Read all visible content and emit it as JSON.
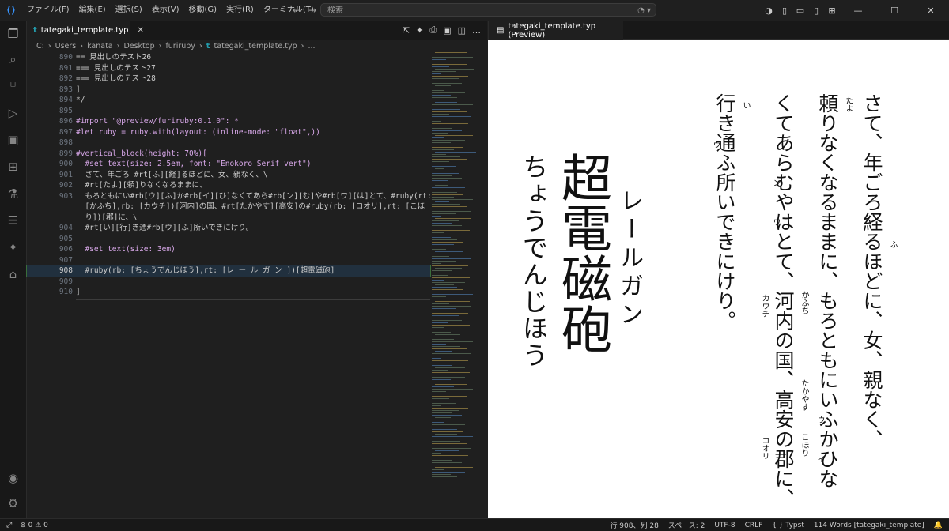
{
  "menu": [
    "ファイル(F)",
    "編集(E)",
    "選択(S)",
    "表示(V)",
    "移動(G)",
    "実行(R)",
    "ターミナル(T)",
    "…"
  ],
  "search": {
    "placeholder": "検索"
  },
  "editor": {
    "tab_label": "tategaki_template.typ",
    "breadcrumb": [
      "C:",
      "Users",
      "kanata",
      "Desktop",
      "furiruby",
      "tategaki_template.typ",
      "..."
    ]
  },
  "code_lines": [
    {
      "n": "890",
      "t": "== 見出しのテスト26"
    },
    {
      "n": "891",
      "t": "=== 見出しのテスト27"
    },
    {
      "n": "892",
      "t": "=== 見出しのテスト28"
    },
    {
      "n": "893",
      "t": "]"
    },
    {
      "n": "894",
      "t": "*/"
    },
    {
      "n": "895",
      "t": ""
    },
    {
      "n": "896",
      "t": "#import \"@preview/furiruby:0.1.0\": *"
    },
    {
      "n": "897",
      "t": "#let ruby = ruby.with(layout: (inline-mode: \"float\",))"
    },
    {
      "n": "898",
      "t": ""
    },
    {
      "n": "899",
      "t": "#vertical_block(height: 70%)["
    },
    {
      "n": "900",
      "t": "  #set text(size: 2.5em, font: \"Enokoro Serif vert\")"
    },
    {
      "n": "901",
      "t": "  さて、年ごろ #rt[ふ][経]るほどに、女、親なく、\\"
    },
    {
      "n": "902",
      "t": "  #rt[たよ][頼]りなくなるままに、"
    },
    {
      "n": "903",
      "t": "  もろともにい#rb[ウ][ふ]か#rb[イ][ひ]なくてあら#rb[ン][む]や#rb[ワ][は]とて、#ruby(rt:"
    },
    {
      "n": "",
      "t": "  [かふち],rb: [カウチ])[河内]の国、#rt[たかやす][高安]の#ruby(rb: [コオリ],rt: [こほ"
    },
    {
      "n": "",
      "t": "  り])[郡]に、\\"
    },
    {
      "n": "904",
      "t": "  #rt[い][行]き通#rb[ウ][ふ]所いできにけり。"
    },
    {
      "n": "905",
      "t": ""
    },
    {
      "n": "906",
      "t": "  #set text(size: 3em)"
    },
    {
      "n": "907",
      "t": ""
    },
    {
      "n": "908",
      "t": "  #ruby(rb: [ちょうでんじほう],rt: [レ ー ル ガ ン ])[超電磁砲]"
    },
    {
      "n": "909",
      "t": ""
    },
    {
      "n": "910",
      "t": "]"
    }
  ],
  "preview": {
    "tab_label": "tategaki_template.typ (Preview)",
    "columns": [
      "さて、年ごろ経るほどに、女、親なく、",
      "頼りなくなるままに、もろともにいふかひな",
      "くてあらむやはとて、河内の国、高安の郡に、",
      "行き通ふ所いできにけり。"
    ],
    "ruby": {
      "fu": "ふ",
      "tayo": "たよ",
      "u1": "ウ",
      "i1": "イ",
      "n": "ン",
      "wa": "ワ",
      "kafuchi": "かふち",
      "kauchi": "カウチ",
      "takayasu": "たかやす",
      "kohori": "こほり",
      "koori": "コオリ",
      "i2": "い",
      "u2": "ウ"
    },
    "big_base": "超電磁砲",
    "big_ruby_over": "レールガン",
    "big_ruby_under": "ちょうでんじほう"
  },
  "status": {
    "errors": "0",
    "warnings": "0",
    "position": "行 908、列 28",
    "spaces": "スペース: 2",
    "encoding": "UTF-8",
    "eol": "CRLF",
    "language": "{ } Typst",
    "words": "114 Words [tategaki_template]"
  }
}
